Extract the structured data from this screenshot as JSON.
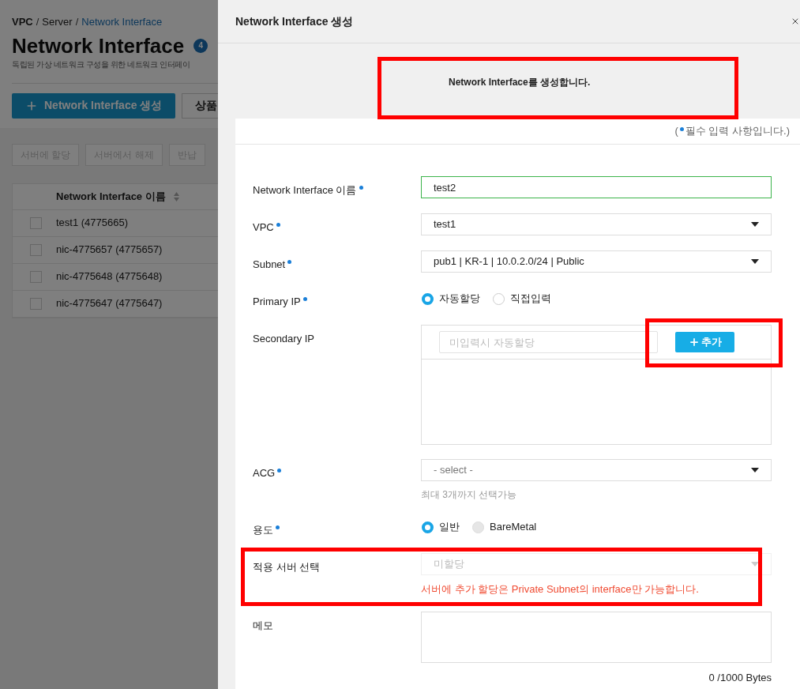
{
  "breadcrumb": [
    {
      "label": "VPC",
      "current": false,
      "separator": "/"
    },
    {
      "label": "Server",
      "current": false,
      "separator": "/"
    },
    {
      "label": "Network Interface",
      "current": true
    }
  ],
  "page": {
    "title": "Network Interface",
    "count": "4",
    "description": "독립된 가상 네트워크 구성을 위한 네트워크 인터페이",
    "primary_button": "Network Interface 생성",
    "secondary_button": "상품"
  },
  "actions": [
    {
      "label": "서버에 할당",
      "disabled": true
    },
    {
      "label": "서버에서 해제",
      "disabled": true
    },
    {
      "label": "반납",
      "disabled": true
    }
  ],
  "table": {
    "columns": [
      "Network Interface 이름"
    ],
    "rows": [
      {
        "name": "test1 (4775665)",
        "checked": false
      },
      {
        "name": "nic-4775657 (4775657)",
        "checked": false
      },
      {
        "name": "nic-4775648 (4775648)",
        "checked": false
      },
      {
        "name": "nic-4775647 (4775647)",
        "checked": false
      }
    ]
  },
  "modal": {
    "title": "Network Interface 생성",
    "intro": "Network Interface를 생성합니다.",
    "intro_highlighted": true,
    "required_note": {
      "open": "(",
      "text": "필수 입력 사항입니다.)"
    },
    "fields": [
      {
        "kind": "text",
        "label": "Network Interface 이름",
        "required": true,
        "value": "test2",
        "focused": true
      },
      {
        "kind": "select",
        "label": "VPC",
        "required": true,
        "value": "test1"
      },
      {
        "kind": "select",
        "label": "Subnet",
        "required": true,
        "value": "pub1 | KR-1 | 10.0.2.0/24 | Public"
      },
      {
        "kind": "radio",
        "label": "Primary IP",
        "required": true,
        "options": [
          {
            "label": "자동할당",
            "selected": true,
            "disabled": false
          },
          {
            "label": "직접입력",
            "selected": false,
            "disabled": false
          }
        ]
      },
      {
        "kind": "ip_list",
        "label": "Secondary IP",
        "required": false,
        "placeholder": "미입력시 자동할당",
        "button": "추가",
        "highlighted": true
      },
      {
        "kind": "select",
        "label": "ACG",
        "required": true,
        "placeholder": "- select -",
        "hint": "최대 3개까지 선택가능"
      },
      {
        "kind": "radio",
        "label": "용도",
        "required": true,
        "options": [
          {
            "label": "일반",
            "selected": true,
            "disabled": false
          },
          {
            "label": "BareMetal",
            "selected": false,
            "disabled": true
          }
        ]
      },
      {
        "kind": "select",
        "label": "적용 서버 선택",
        "required": false,
        "placeholder": "미할당",
        "disabled": true,
        "error": "서버에 추가 할당은 Private Subnet의 interface만 가능합니다.",
        "highlighted": true
      },
      {
        "kind": "textarea",
        "label": "메모",
        "required": false,
        "counter": "0 /1000 Bytes"
      }
    ]
  }
}
